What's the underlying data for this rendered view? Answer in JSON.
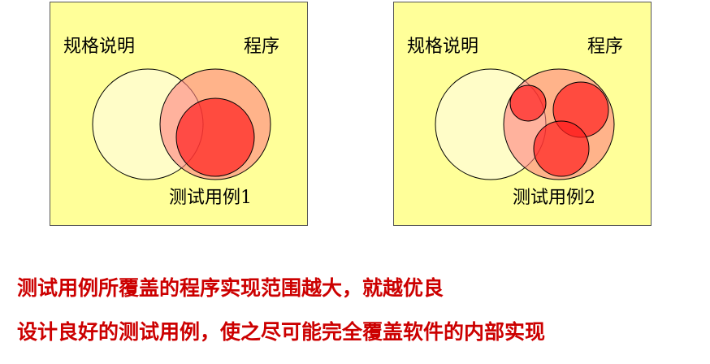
{
  "diagram_1": {
    "spec_label": "规格说明",
    "program_label": "程序",
    "test_case_label": "测试用例1"
  },
  "diagram_2": {
    "spec_label": "规格说明",
    "program_label": "程序",
    "test_case_label": "测试用例2"
  },
  "caption": {
    "line_1": "测试用例所覆盖的程序实现范围越大，就越优良",
    "line_2": "设计良好的测试用例，使之尽可能完全覆盖软件的内部实现"
  },
  "colors": {
    "panel_background": "#ffff99",
    "spec_circle": "#ffffcc",
    "program_circle": "#ff9999",
    "test_case_circle": "#ff3333",
    "caption_text": "#cc0000"
  }
}
